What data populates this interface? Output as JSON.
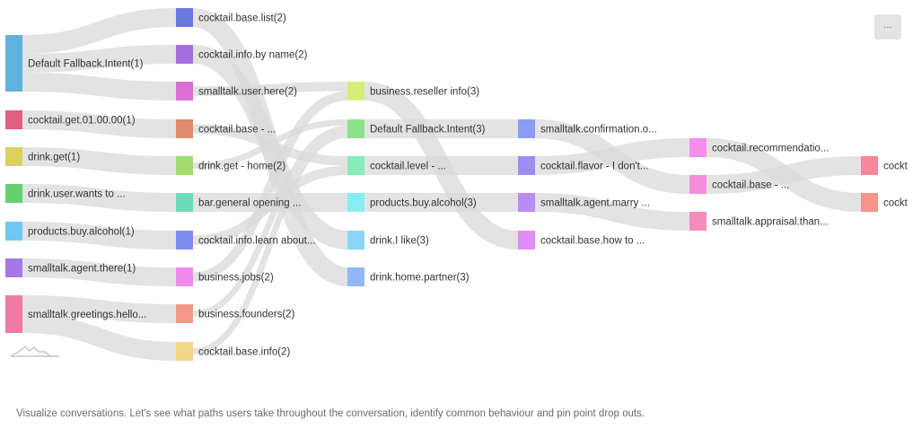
{
  "menu_button": {
    "label": "···"
  },
  "caption": "Visualize conversations. Let's see what paths users take throughout the conversation, identify common behaviour and pin point drop outs.",
  "flow": {
    "link_color": "#d9d9d9",
    "nodes": [
      {
        "id": "n0",
        "col": 0,
        "label": "Default Fallback.Intent(1)",
        "color": "#5fb3dc"
      },
      {
        "id": "n1",
        "col": 0,
        "label": "cocktail.get.01.00.00(1)",
        "color": "#e0607e"
      },
      {
        "id": "n2",
        "col": 0,
        "label": "drink.get(1)",
        "color": "#dcd060"
      },
      {
        "id": "n3",
        "col": 0,
        "label": "drink.user.wants to ...",
        "color": "#65d06e"
      },
      {
        "id": "n4",
        "col": 0,
        "label": "products.buy.alcohol(1)",
        "color": "#70c8f0"
      },
      {
        "id": "n5",
        "col": 0,
        "label": "smalltalk.agent.there(1)",
        "color": "#a877e6"
      },
      {
        "id": "n6",
        "col": 0,
        "label": "smalltalk.greetings.hello...",
        "color": "#f07aa6"
      },
      {
        "id": "m0",
        "col": 1,
        "label": "cocktail.base.list(2)",
        "color": "#6b78e0"
      },
      {
        "id": "m1",
        "col": 1,
        "label": "cocktail.info.by name(2)",
        "color": "#a86ddc"
      },
      {
        "id": "m2",
        "col": 1,
        "label": "smalltalk.user.here(2)",
        "color": "#dc6ed6"
      },
      {
        "id": "m3",
        "col": 1,
        "label": "cocktail.base - ...",
        "color": "#e08a6e"
      },
      {
        "id": "m4",
        "col": 1,
        "label": "drink.get - home(2)",
        "color": "#a2dc6c"
      },
      {
        "id": "m5",
        "col": 1,
        "label": "bar.general opening ...",
        "color": "#6cdcb8"
      },
      {
        "id": "m6",
        "col": 1,
        "label": "cocktail.info.learn about...",
        "color": "#7e8cf0"
      },
      {
        "id": "m7",
        "col": 1,
        "label": "business.jobs(2)",
        "color": "#f08af0"
      },
      {
        "id": "m8",
        "col": 1,
        "label": "business.founders(2)",
        "color": "#f59a86"
      },
      {
        "id": "m9",
        "col": 1,
        "label": "cocktail.base.info(2)",
        "color": "#f3d88a"
      },
      {
        "id": "p0",
        "col": 2,
        "label": "business.reseller info(3)",
        "color": "#d4f07a"
      },
      {
        "id": "p1",
        "col": 2,
        "label": "Default Fallback.Intent(3)",
        "color": "#8ae38a"
      },
      {
        "id": "p2",
        "col": 2,
        "label": "cocktail.level - ...",
        "color": "#86ecb8"
      },
      {
        "id": "p3",
        "col": 2,
        "label": "products.buy.alcohol(3)",
        "color": "#86eef0"
      },
      {
        "id": "p4",
        "col": 2,
        "label": "drink.I like(3)",
        "color": "#8ad6f6"
      },
      {
        "id": "p5",
        "col": 2,
        "label": "drink.home.partner(3)",
        "color": "#90b8f8"
      },
      {
        "id": "q0",
        "col": 3,
        "label": "smalltalk.confirmation.o...",
        "color": "#8c9cf6"
      },
      {
        "id": "q1",
        "col": 3,
        "label": "cocktail.flavor - I don't...",
        "color": "#9e8cf6"
      },
      {
        "id": "q2",
        "col": 3,
        "label": "smalltalk.agent.marry ...",
        "color": "#ba8cf6"
      },
      {
        "id": "q3",
        "col": 3,
        "label": "cocktail.base.how to ...",
        "color": "#e08cf6"
      },
      {
        "id": "r0",
        "col": 4,
        "label": "cocktail.recommendatio...",
        "color": "#f68cec"
      },
      {
        "id": "r1",
        "col": 4,
        "label": "cocktail.base - ...",
        "color": "#f68cdc"
      },
      {
        "id": "r2",
        "col": 4,
        "label": "smalltalk.appraisal.than...",
        "color": "#f68cbc"
      },
      {
        "id": "s0",
        "col": 5,
        "label": "cockt",
        "color": "#f6889c"
      },
      {
        "id": "s1",
        "col": 5,
        "label": "cockt",
        "color": "#f6958a"
      }
    ],
    "links": [
      [
        "n0",
        "m0"
      ],
      [
        "n0",
        "m1"
      ],
      [
        "n0",
        "m2"
      ],
      [
        "n1",
        "m3"
      ],
      [
        "n2",
        "m4"
      ],
      [
        "n3",
        "m5"
      ],
      [
        "n4",
        "m6"
      ],
      [
        "n5",
        "m7"
      ],
      [
        "n6",
        "m8"
      ],
      [
        "n6",
        "m9"
      ],
      [
        "m0",
        "p5"
      ],
      [
        "m1",
        "p4"
      ],
      [
        "m2",
        "p0"
      ],
      [
        "m3",
        "p2"
      ],
      [
        "m4",
        "p1"
      ],
      [
        "m5",
        "p3"
      ],
      [
        "m6",
        "p2"
      ],
      [
        "m7",
        "p0"
      ],
      [
        "m8",
        "p1"
      ],
      [
        "m9",
        "p1"
      ],
      [
        "p0",
        "q3"
      ],
      [
        "p1",
        "q0"
      ],
      [
        "p2",
        "q1"
      ],
      [
        "p3",
        "q2"
      ],
      [
        "q0",
        "r1"
      ],
      [
        "q1",
        "r0"
      ],
      [
        "q2",
        "r2"
      ],
      [
        "r0",
        "s1"
      ],
      [
        "r1",
        "s0"
      ]
    ]
  }
}
